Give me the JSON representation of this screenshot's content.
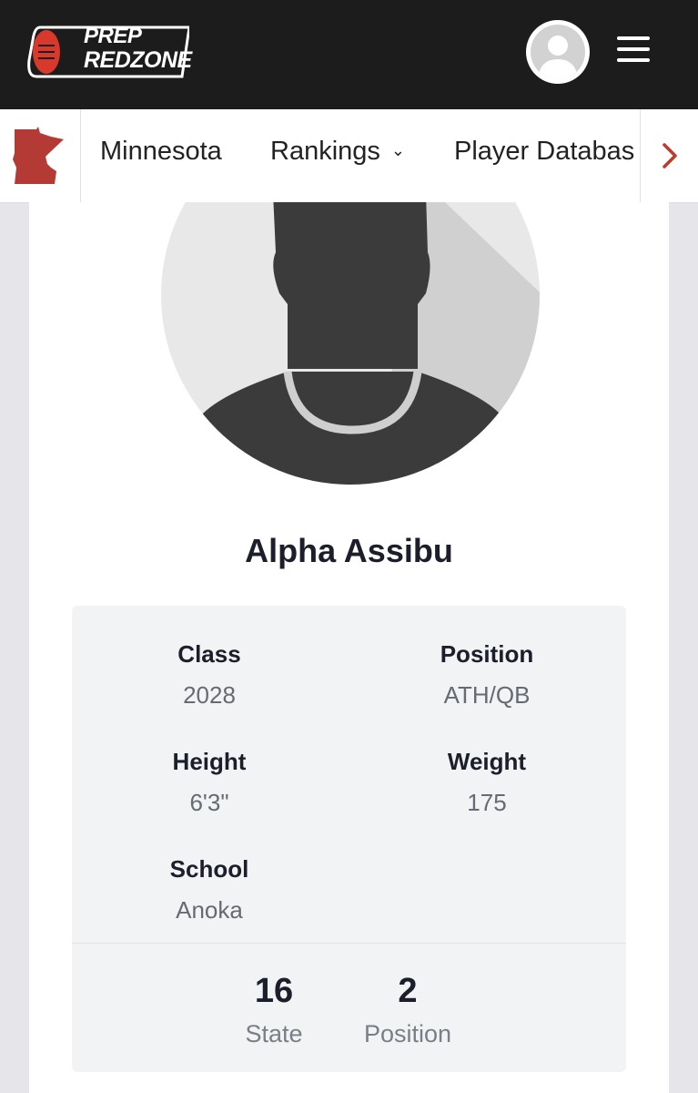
{
  "header": {
    "logo_line1": "PREP",
    "logo_line2": "REDZONE",
    "brand_color": "#d9392c"
  },
  "nav": {
    "state_icon": "minnesota-state-icon",
    "items": [
      {
        "label": "Minnesota"
      },
      {
        "label": "Rankings"
      },
      {
        "label": "Player Databas"
      }
    ]
  },
  "player": {
    "name": "Alpha Assibu",
    "stats": [
      {
        "label": "Class",
        "value": "2028"
      },
      {
        "label": "Position",
        "value": "ATH/QB"
      },
      {
        "label": "Height",
        "value": "6'3\""
      },
      {
        "label": "Weight",
        "value": "175"
      },
      {
        "label": "School",
        "value": "Anoka"
      }
    ],
    "rankings": [
      {
        "number": "16",
        "label": "State"
      },
      {
        "number": "2",
        "label": "Position"
      }
    ]
  }
}
